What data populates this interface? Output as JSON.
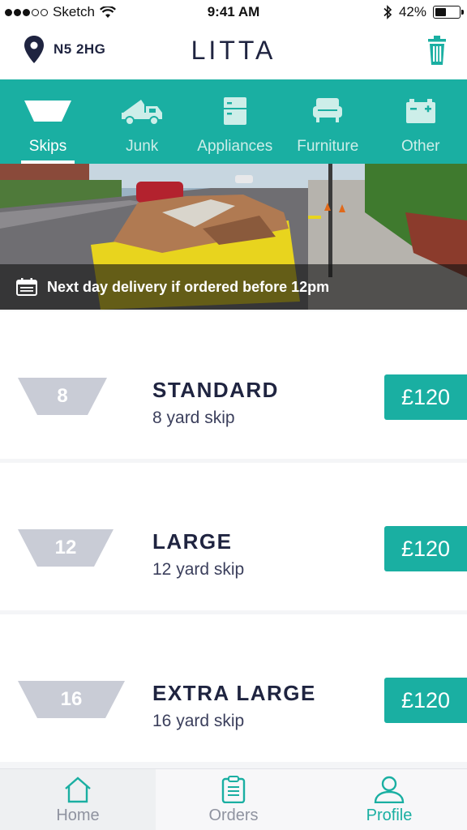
{
  "status_bar": {
    "carrier": "Sketch",
    "time": "9:41 AM",
    "battery": "42%"
  },
  "header": {
    "location": "N5 2HG",
    "brand": "LITTA"
  },
  "tabs": [
    {
      "label": "Skips",
      "icon": "skip-icon"
    },
    {
      "label": "Junk",
      "icon": "truck-icon"
    },
    {
      "label": "Appliances",
      "icon": "appliance-icon"
    },
    {
      "label": "Furniture",
      "icon": "sofa-icon"
    },
    {
      "label": "Other",
      "icon": "battery-box-icon"
    }
  ],
  "hero": {
    "banner_text": "Next day delivery if ordered before 12pm"
  },
  "skips": [
    {
      "size": "8",
      "title": "STANDARD",
      "subtitle": "8 yard skip",
      "price": "£120"
    },
    {
      "size": "12",
      "title": "LARGE",
      "subtitle": "12 yard skip",
      "price": "£120"
    },
    {
      "size": "16",
      "title": "EXTRA LARGE",
      "subtitle": "16 yard skip",
      "price": "£120"
    }
  ],
  "bottom_nav": [
    {
      "label": "Home",
      "icon": "home-icon"
    },
    {
      "label": "Orders",
      "icon": "clipboard-icon"
    },
    {
      "label": "Profile",
      "icon": "user-icon"
    }
  ],
  "colors": {
    "teal": "#1aafa2",
    "navy": "#1f2440",
    "tag_grey": "#c9ccd6"
  }
}
